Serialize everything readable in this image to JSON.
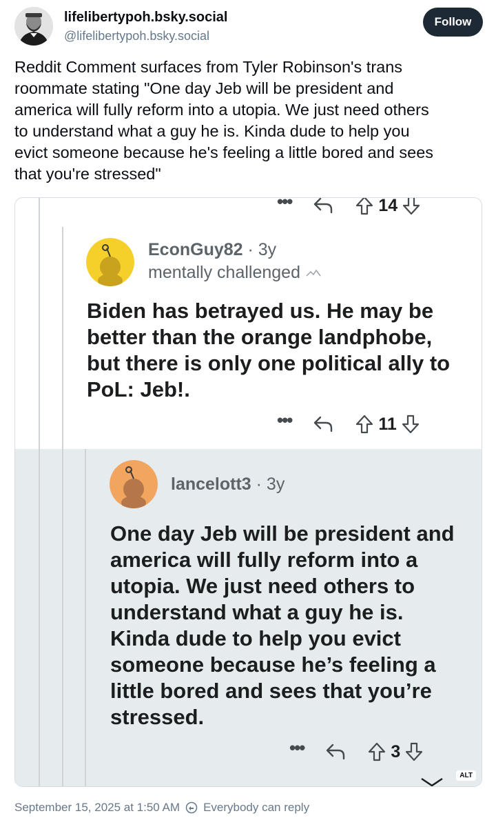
{
  "author": {
    "display_name": "lifelibertypoh.bsky.social",
    "handle": "@lifelibertypoh.bsky.social"
  },
  "follow_label": "Follow",
  "post": {
    "text": "Reddit Comment surfaces from Tyler Robinson's trans\nroommate stating \"One day Jeb will be president and\namerica will fully reform into a utopia. We just need others\nto understand what a guy he is. Kinda dude to help you\nevict someone because he's feeling a little bored and sees\nthat you're stressed\""
  },
  "screenshot": {
    "top_row": {
      "dots": "•••",
      "count": "14"
    },
    "comment1": {
      "username": "EconGuy82",
      "age": "3y",
      "flair": "mentally challenged",
      "body": "Biden has betrayed us. He may be\nbetter than the orange landphobe,\nbut there is only one political ally to\nPoL: Jeb!.",
      "dots": "•••",
      "count": "11"
    },
    "comment2": {
      "username": "lancelott3",
      "age": "3y",
      "body": "One day Jeb will be president and\namerica will fully reform into a\nutopia. We just need others to\nunderstand what a guy he is.\nKinda dude to help you evict\nsomeone because he’s feeling a\nlittle bored and sees that you’re\nstressed.",
      "dots": "•••",
      "count": "3"
    },
    "alt_label": "ALT"
  },
  "footer": {
    "timestamp": "September 15, 2025 at 1:50 AM",
    "reply_setting": "Everybody can reply"
  },
  "colors": {
    "follow_bg": "#1e2936",
    "muted": "#66788a",
    "snoo1": "#f5d02a",
    "snoo2": "#f2a55f",
    "nested_bg": "#e6ebee"
  }
}
